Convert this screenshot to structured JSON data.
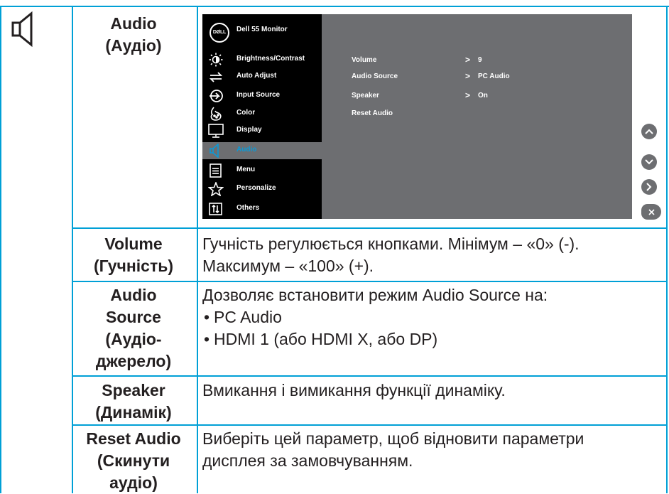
{
  "row0": {
    "param": [
      "Audio",
      "(Аудіо)"
    ]
  },
  "osd": {
    "logo": "DØLL",
    "title": "Dell 55 Monitor",
    "menu": [
      {
        "label": "Brightness/Contrast",
        "icon": "brightness-icon"
      },
      {
        "label": "Auto Adjust",
        "icon": "auto-adjust-icon"
      },
      {
        "label": "Input Source",
        "icon": "input-source-icon"
      },
      {
        "label": "Color",
        "icon": "color-icon"
      },
      {
        "label": "Display",
        "icon": "display-icon"
      },
      {
        "label": "Audio",
        "icon": "speaker-icon",
        "active": true
      },
      {
        "label": "Menu",
        "icon": "menu-icon"
      },
      {
        "label": "Personalize",
        "icon": "star-icon"
      },
      {
        "label": "Others",
        "icon": "others-icon"
      }
    ],
    "submenu": [
      {
        "label": "Volume",
        "value": "9"
      },
      {
        "label": "Audio Source",
        "value": "PC Audio"
      },
      {
        "label": "Speaker",
        "value": "On"
      },
      {
        "label": "Reset Audio",
        "value": ""
      }
    ],
    "accent": "#0b9ad7"
  },
  "rows": [
    {
      "param": [
        "Volume",
        "(Гучність)"
      ],
      "desc": [
        "Гучність регулюється кнопками. Мінімум – «0» (-).",
        "Максимум – «100» (+)."
      ]
    },
    {
      "param": [
        "Audio",
        "Source",
        "(Аудіо-",
        "джерело)"
      ],
      "desc": [
        "Дозволяє встановити режим Audio Source на:"
      ],
      "bullets": [
        "PC Audio",
        "HDMI 1 (або HDMI X, або DP)"
      ]
    },
    {
      "param": [
        "Speaker",
        "(Динамік)"
      ],
      "desc": [
        "Вмикання і вимикання функції динаміку."
      ]
    },
    {
      "param": [
        "Reset Audio",
        "(Скинути",
        "аудіо)"
      ],
      "desc": [
        "Виберіть цей параметр, щоб відновити параметри",
        "дисплея за замовчуванням."
      ]
    }
  ],
  "side_buttons": [
    "up-icon",
    "down-icon",
    "right-icon",
    "close-icon"
  ],
  "border_color": "#00a0d6"
}
